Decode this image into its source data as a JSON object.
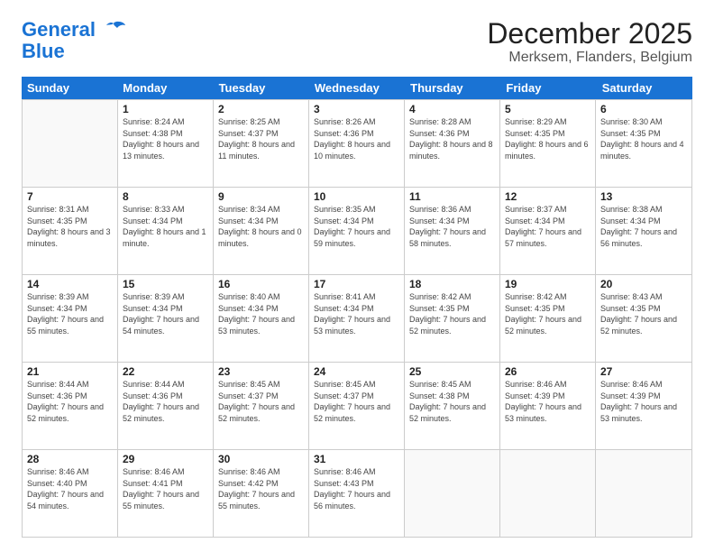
{
  "header": {
    "logo": {
      "line1": "General",
      "line2": "Blue"
    },
    "title": "December 2025",
    "subtitle": "Merksem, Flanders, Belgium"
  },
  "calendar": {
    "days_of_week": [
      "Sunday",
      "Monday",
      "Tuesday",
      "Wednesday",
      "Thursday",
      "Friday",
      "Saturday"
    ],
    "rows": [
      [
        {
          "day": "",
          "empty": true
        },
        {
          "day": "1",
          "sunrise": "Sunrise: 8:24 AM",
          "sunset": "Sunset: 4:38 PM",
          "daylight": "Daylight: 8 hours and 13 minutes."
        },
        {
          "day": "2",
          "sunrise": "Sunrise: 8:25 AM",
          "sunset": "Sunset: 4:37 PM",
          "daylight": "Daylight: 8 hours and 11 minutes."
        },
        {
          "day": "3",
          "sunrise": "Sunrise: 8:26 AM",
          "sunset": "Sunset: 4:36 PM",
          "daylight": "Daylight: 8 hours and 10 minutes."
        },
        {
          "day": "4",
          "sunrise": "Sunrise: 8:28 AM",
          "sunset": "Sunset: 4:36 PM",
          "daylight": "Daylight: 8 hours and 8 minutes."
        },
        {
          "day": "5",
          "sunrise": "Sunrise: 8:29 AM",
          "sunset": "Sunset: 4:35 PM",
          "daylight": "Daylight: 8 hours and 6 minutes."
        },
        {
          "day": "6",
          "sunrise": "Sunrise: 8:30 AM",
          "sunset": "Sunset: 4:35 PM",
          "daylight": "Daylight: 8 hours and 4 minutes."
        }
      ],
      [
        {
          "day": "7",
          "sunrise": "Sunrise: 8:31 AM",
          "sunset": "Sunset: 4:35 PM",
          "daylight": "Daylight: 8 hours and 3 minutes."
        },
        {
          "day": "8",
          "sunrise": "Sunrise: 8:33 AM",
          "sunset": "Sunset: 4:34 PM",
          "daylight": "Daylight: 8 hours and 1 minute."
        },
        {
          "day": "9",
          "sunrise": "Sunrise: 8:34 AM",
          "sunset": "Sunset: 4:34 PM",
          "daylight": "Daylight: 8 hours and 0 minutes."
        },
        {
          "day": "10",
          "sunrise": "Sunrise: 8:35 AM",
          "sunset": "Sunset: 4:34 PM",
          "daylight": "Daylight: 7 hours and 59 minutes."
        },
        {
          "day": "11",
          "sunrise": "Sunrise: 8:36 AM",
          "sunset": "Sunset: 4:34 PM",
          "daylight": "Daylight: 7 hours and 58 minutes."
        },
        {
          "day": "12",
          "sunrise": "Sunrise: 8:37 AM",
          "sunset": "Sunset: 4:34 PM",
          "daylight": "Daylight: 7 hours and 57 minutes."
        },
        {
          "day": "13",
          "sunrise": "Sunrise: 8:38 AM",
          "sunset": "Sunset: 4:34 PM",
          "daylight": "Daylight: 7 hours and 56 minutes."
        }
      ],
      [
        {
          "day": "14",
          "sunrise": "Sunrise: 8:39 AM",
          "sunset": "Sunset: 4:34 PM",
          "daylight": "Daylight: 7 hours and 55 minutes."
        },
        {
          "day": "15",
          "sunrise": "Sunrise: 8:39 AM",
          "sunset": "Sunset: 4:34 PM",
          "daylight": "Daylight: 7 hours and 54 minutes."
        },
        {
          "day": "16",
          "sunrise": "Sunrise: 8:40 AM",
          "sunset": "Sunset: 4:34 PM",
          "daylight": "Daylight: 7 hours and 53 minutes."
        },
        {
          "day": "17",
          "sunrise": "Sunrise: 8:41 AM",
          "sunset": "Sunset: 4:34 PM",
          "daylight": "Daylight: 7 hours and 53 minutes."
        },
        {
          "day": "18",
          "sunrise": "Sunrise: 8:42 AM",
          "sunset": "Sunset: 4:35 PM",
          "daylight": "Daylight: 7 hours and 52 minutes."
        },
        {
          "day": "19",
          "sunrise": "Sunrise: 8:42 AM",
          "sunset": "Sunset: 4:35 PM",
          "daylight": "Daylight: 7 hours and 52 minutes."
        },
        {
          "day": "20",
          "sunrise": "Sunrise: 8:43 AM",
          "sunset": "Sunset: 4:35 PM",
          "daylight": "Daylight: 7 hours and 52 minutes."
        }
      ],
      [
        {
          "day": "21",
          "sunrise": "Sunrise: 8:44 AM",
          "sunset": "Sunset: 4:36 PM",
          "daylight": "Daylight: 7 hours and 52 minutes."
        },
        {
          "day": "22",
          "sunrise": "Sunrise: 8:44 AM",
          "sunset": "Sunset: 4:36 PM",
          "daylight": "Daylight: 7 hours and 52 minutes."
        },
        {
          "day": "23",
          "sunrise": "Sunrise: 8:45 AM",
          "sunset": "Sunset: 4:37 PM",
          "daylight": "Daylight: 7 hours and 52 minutes."
        },
        {
          "day": "24",
          "sunrise": "Sunrise: 8:45 AM",
          "sunset": "Sunset: 4:37 PM",
          "daylight": "Daylight: 7 hours and 52 minutes."
        },
        {
          "day": "25",
          "sunrise": "Sunrise: 8:45 AM",
          "sunset": "Sunset: 4:38 PM",
          "daylight": "Daylight: 7 hours and 52 minutes."
        },
        {
          "day": "26",
          "sunrise": "Sunrise: 8:46 AM",
          "sunset": "Sunset: 4:39 PM",
          "daylight": "Daylight: 7 hours and 53 minutes."
        },
        {
          "day": "27",
          "sunrise": "Sunrise: 8:46 AM",
          "sunset": "Sunset: 4:39 PM",
          "daylight": "Daylight: 7 hours and 53 minutes."
        }
      ],
      [
        {
          "day": "28",
          "sunrise": "Sunrise: 8:46 AM",
          "sunset": "Sunset: 4:40 PM",
          "daylight": "Daylight: 7 hours and 54 minutes."
        },
        {
          "day": "29",
          "sunrise": "Sunrise: 8:46 AM",
          "sunset": "Sunset: 4:41 PM",
          "daylight": "Daylight: 7 hours and 55 minutes."
        },
        {
          "day": "30",
          "sunrise": "Sunrise: 8:46 AM",
          "sunset": "Sunset: 4:42 PM",
          "daylight": "Daylight: 7 hours and 55 minutes."
        },
        {
          "day": "31",
          "sunrise": "Sunrise: 8:46 AM",
          "sunset": "Sunset: 4:43 PM",
          "daylight": "Daylight: 7 hours and 56 minutes."
        },
        {
          "day": "",
          "empty": true
        },
        {
          "day": "",
          "empty": true
        },
        {
          "day": "",
          "empty": true
        }
      ]
    ]
  }
}
